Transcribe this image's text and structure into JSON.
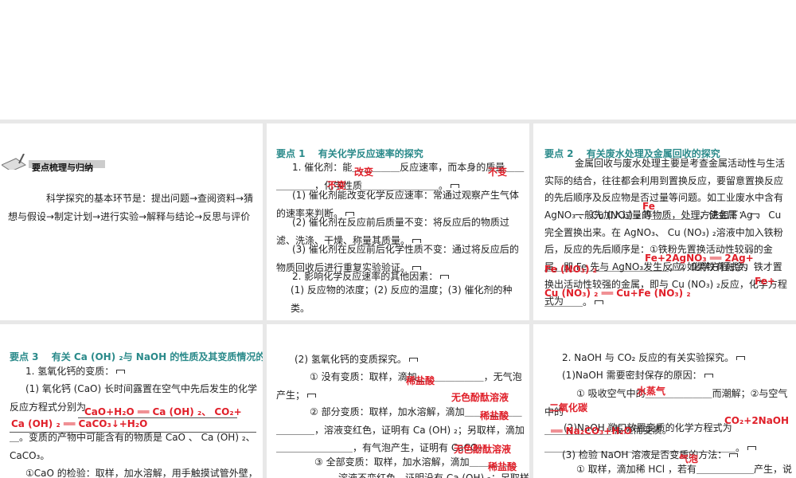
{
  "p0": {
    "banner": "要点梳理与归纳",
    "text": "科学探究的基本环节是：提出问题→查阅资料→猜想与假设→制定计划→进行实验→解释与结论→反思与评价"
  },
  "p1": {
    "title": "要点 1　 有关化学反应速率的探究",
    "l1": "1. 催化剂：能＿＿＿＿＿反应速率，而本身的质量＿＿＿＿＿＿，化学性质＿＿＿＿＿＿＿＿。",
    "l2": "(1) 催化剂能改变化学反应速率：常通过观察产生气体的速率来判断。",
    "l3": "(2) 催化剂在反应前后质量不变：将反应后的物质过滤、洗涤、干燥、称量其质量。",
    "l4": "(3) 催化剂在反应前后化学性质不变：通过将反应后的物质回收后进行重复实验验证。",
    "l5": "2. 影响化学反应速率的其他因素：",
    "l6": "(1) 反应物的浓度；(2) 反应的温度；(3) 催化剂的种类。",
    "a1": "改变",
    "a2": "不变",
    "a3": "不变"
  },
  "p2": {
    "title": "要点 2　 有关废水处理及金属回收的探究",
    "l1": "金属回收与废水处理主要是考查金属活动性与生活实际的结合，往往都会利用到置换反应，要留意置换反应的先后顺序及反应物是否过量等问题。如工业废水中含有 AgNO₃ 、 Cu (NO₃) ₂ 等物质，处理方法如下：",
    "l2": "一般先加入过量的＿＿＿＿＿，使金属 Ag 、 Cu 完全置换出来。在 AgNO₃、 Cu (NO₃) ₂溶液中加入铁粉后，反应的先后顺序是：①铁粉先置换活动性较弱的金属，即 Fe 先与 AgNO₃发生反应，化学方程式为",
    "l3": "＿＿＿＿＿＿＿＿＿＿＿＿＿；②如果铁有剩余，铁才置换出活动性较强的金属，即与 Cu (NO₃) ₂反应，化学方程式为",
    "l4": "＿＿＿＿。",
    "a1": "Fe",
    "a2": "Fe+2AgNO₃ ══ 2Ag+",
    "a3": "Fe (NO₃) ₂",
    "a4": "Fe+",
    "a5": "Cu (NO₃) ₂ ══ Cu+Fe (NO₃) ₂"
  },
  "p3": {
    "title": "要点 3　 有关 Ca (OH) ₂与 NaOH 的性质及其变质情况的探究",
    "l1": "1. 氢氧化钙的变质：",
    "l2": "(1) 氧化钙 (CaO) 长时间露置在空气中先后发生的化学反应方程式分别为",
    "l3": "＿。变质的产物中可能含有的物质是 CaO 、 Ca (OH) ₂、CaCO₃。",
    "l4": "①CaO 的检验：取样，加水溶解，用手触摸试管外壁，",
    "a1": "CaO+H₂O ══ Ca (OH) ₂、 CO₂+",
    "a2": "Ca (OH) ₂ ══ CaCO₃↓+H₂O"
  },
  "p4": {
    "l1": "(2) 氢氧化钙的变质探究。",
    "l2": "① 没有变质：取样，滴加＿＿＿＿＿＿＿，无气泡产生；",
    "l3": "② 部分变质：取样，加水溶解，滴加＿＿＿＿＿＿＿＿＿＿，溶液变红色，证明有 Ca (OH) ₂；另取样，滴加＿＿＿＿＿＿＿＿，有气泡产生，证明有 CaCO₃",
    "l4": "③ 全部变质：取样，加水溶解，滴加＿＿＿＿＿",
    "l5": "溶液不变红色，证明没有 Ca (OH) ₂；另取样",
    "a1": "稀盐酸",
    "a2": "无色酚酞溶液",
    "a3": "稀盐酸",
    "a4": "无色酚酞溶液",
    "a5": "稀盐酸"
  },
  "p5": {
    "l1": "2. NaOH 与 CO₂ 反应的有关实验探究。",
    "l2": "(1)NaOH 需要密封保存的原因：",
    "l3": "① 吸收空气中的＿＿＿＿＿＿＿而潮解；②与空气中的",
    "l4": "＿＿＿＿＿＿＿ 反应而变质。",
    "l5": "(2)NaOH 敞口放置变质的化学方程式为",
    "l6": "＿＿＿＿＿＿＿＿＿＿＿＿＿＿＿＿＿＿＿＿。",
    "l7": "(3) 检验 NaOH 溶液是否变质的方法：",
    "l8": "① 取样，滴加稀 HCl ，若有＿＿＿＿＿＿产生，说",
    "a1": "水蒸气",
    "a2": "二氧化碳",
    "a3": "CO₂+2NaOH",
    "a4": "══ Na₂CO₃+H₂O",
    "a5": "气泡"
  }
}
